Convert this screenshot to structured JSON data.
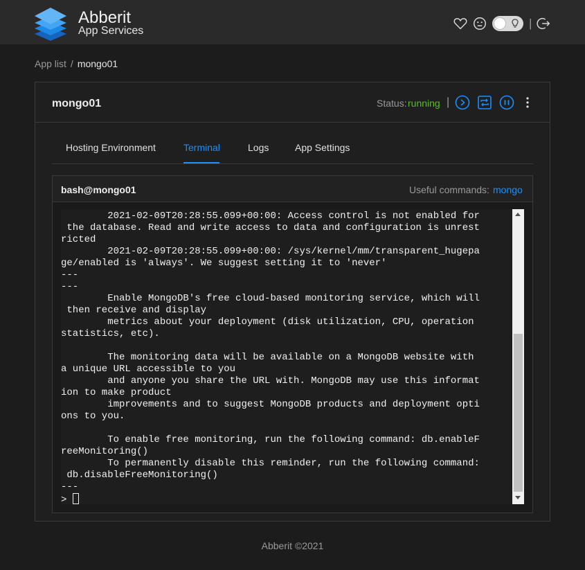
{
  "header": {
    "brand_title": "Abberit",
    "brand_subtitle": "App Services",
    "icons": [
      "layers-logo",
      "heart-icon",
      "feedback-face-icon",
      "theme-toggle",
      "logout-icon"
    ],
    "separator": "|"
  },
  "breadcrumb": {
    "parent": "App list",
    "separator": "/",
    "current": "mongo01"
  },
  "app": {
    "name": "mongo01",
    "status_label": "Status:",
    "status_value": "running",
    "status_separator": "|",
    "actions": [
      "play-circle-icon",
      "restart-icon",
      "pause-circle-icon",
      "more-vert-icon"
    ]
  },
  "tabs": [
    {
      "label": "Hosting Environment",
      "active": false
    },
    {
      "label": "Terminal",
      "active": true
    },
    {
      "label": "Logs",
      "active": false
    },
    {
      "label": "App Settings",
      "active": false
    }
  ],
  "terminal": {
    "title": "bash@mongo01",
    "useful_label": "Useful commands:",
    "useful_command": "mongo",
    "output": "        2021-02-09T20:28:55.099+00:00: Access control is not enabled for\n the database. Read and write access to data and configuration is unrest\nricted\n        2021-02-09T20:28:55.099+00:00: /sys/kernel/mm/transparent_hugepa\nge/enabled is 'always'. We suggest setting it to 'never'\n---\n---\n        Enable MongoDB's free cloud-based monitoring service, which will\n then receive and display\n        metrics about your deployment (disk utilization, CPU, operation\nstatistics, etc).\n\n        The monitoring data will be available on a MongoDB website with\na unique URL accessible to you\n        and anyone you share the URL with. MongoDB may use this informat\nion to make product\n        improvements and to suggest MongoDB products and deployment opti\nons to you.\n\n        To enable free monitoring, run the following command: db.enableF\nreeMonitoring()\n        To permanently disable this reminder, run the following command:\n db.disableFreeMonitoring()\n---\n",
    "prompt": "> "
  },
  "footer": {
    "text": "Abberit ©2021"
  },
  "colors": {
    "accent": "#1890ff",
    "status_running": "#52c41a",
    "header_bg": "#2a2a2a",
    "page_bg": "#1c1c1c"
  }
}
